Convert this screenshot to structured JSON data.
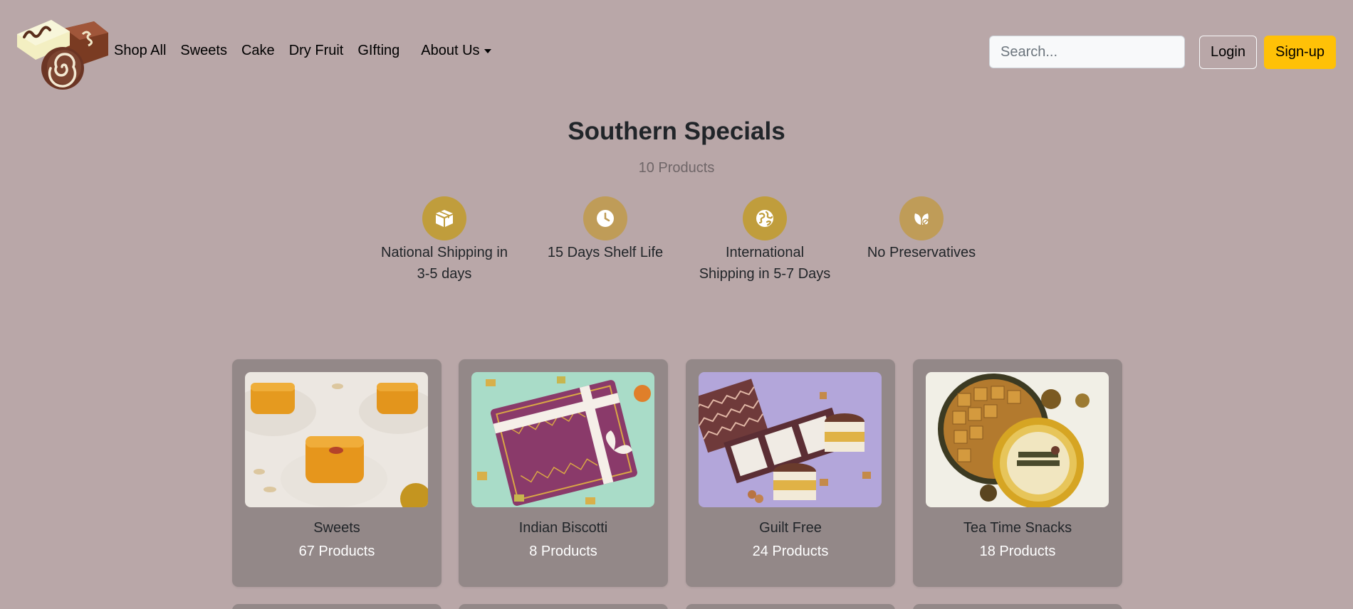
{
  "nav": {
    "links": [
      "Shop All",
      "Sweets",
      "Cake",
      "Dry Fruit",
      "GIfting"
    ],
    "dropdown_label": "About Us",
    "search_placeholder": "Search...",
    "login_label": "Login",
    "signup_label": "Sign-up"
  },
  "header": {
    "title": "Southern Specials",
    "product_count": "10 Products"
  },
  "features": [
    {
      "icon": "box-icon",
      "line1": "National Shipping in",
      "line2": "3-5 days"
    },
    {
      "icon": "clock-icon",
      "line1": "15 Days Shelf Life",
      "line2": ""
    },
    {
      "icon": "globe-icon",
      "line1": "International",
      "line2": "Shipping in 5-7 Days"
    },
    {
      "icon": "leaf-icon",
      "line1": "No Preservatives",
      "line2": ""
    }
  ],
  "categories": [
    {
      "title": "Sweets",
      "count": "67 Products"
    },
    {
      "title": "Indian Biscotti",
      "count": "8 Products"
    },
    {
      "title": "Guilt Free",
      "count": "24 Products"
    },
    {
      "title": "Tea Time Snacks",
      "count": "18 Products"
    }
  ],
  "colors": {
    "background": "#b9a7a8",
    "card": "#938888",
    "accent_gold": "#c09d3c",
    "signup": "#ffc107"
  }
}
